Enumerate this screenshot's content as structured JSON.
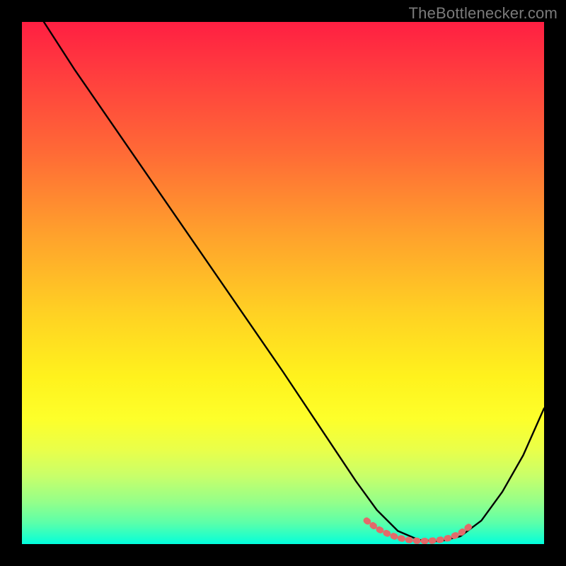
{
  "attribution": "TheBottlenecker.com",
  "chart_data": {
    "type": "line",
    "title": "",
    "xlabel": "",
    "ylabel": "",
    "xlim": [
      0,
      100
    ],
    "ylim": [
      0,
      100
    ],
    "series": [
      {
        "name": "curve",
        "x": [
          4.2,
          10,
          20,
          30,
          40,
          50,
          56,
          60,
          64,
          68,
          72,
          76,
          80,
          84,
          88,
          92,
          96,
          100
        ],
        "y": [
          100,
          91,
          76.5,
          62,
          47.5,
          33,
          24,
          18,
          12,
          6.5,
          2.5,
          0.8,
          0.5,
          1.5,
          4.5,
          10,
          17,
          26
        ]
      },
      {
        "name": "highlight",
        "x": [
          66,
          68,
          70,
          72,
          74,
          76,
          78,
          80,
          82,
          84,
          86
        ],
        "y": [
          4.5,
          3.0,
          2.0,
          1.2,
          0.8,
          0.6,
          0.6,
          0.8,
          1.2,
          2.1,
          3.6
        ]
      }
    ],
    "colors": {
      "curve": "#000000",
      "highlight": "#e36a6a"
    },
    "note": "Axes are unlabeled; values are read as percentages of plot area with origin at bottom-left."
  }
}
